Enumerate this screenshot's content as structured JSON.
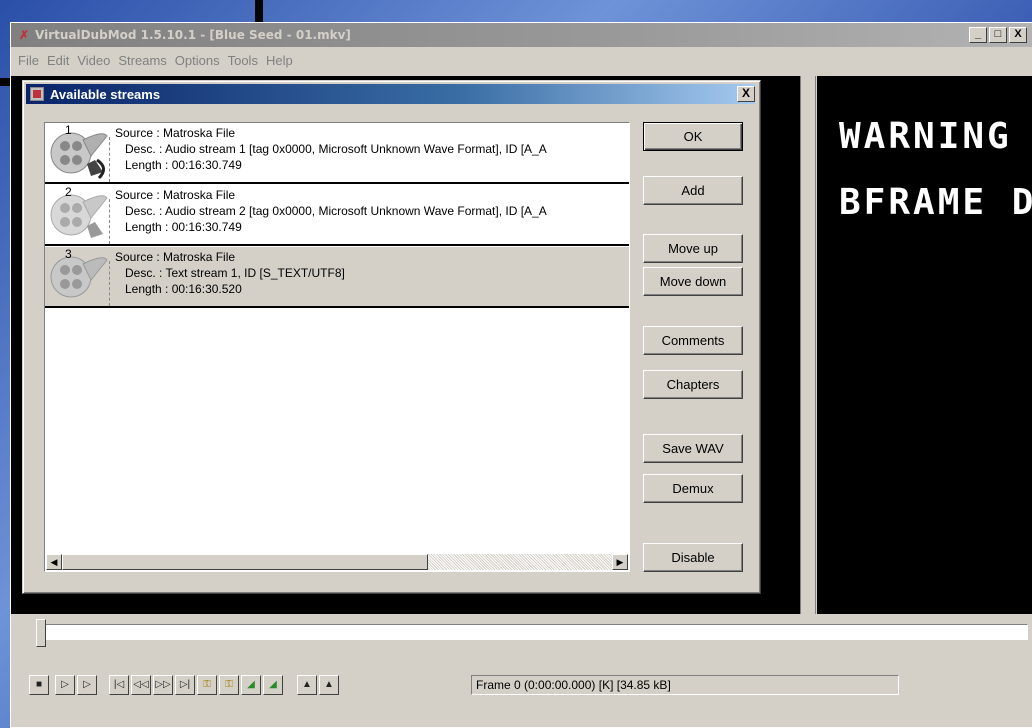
{
  "window": {
    "title": "VirtualDubMod 1.5.10.1 - [Blue Seed - 01.mkv]",
    "controls": [
      "_",
      "□",
      "X"
    ]
  },
  "menu": [
    "File",
    "Edit",
    "Video",
    "Streams",
    "Options",
    "Tools",
    "Help"
  ],
  "video": {
    "line1": "WARNING",
    "line2": "BFRAME D"
  },
  "dialog": {
    "title": "Available streams",
    "close": "X",
    "streams": [
      {
        "num": "1",
        "icon": "audio-stream-icon",
        "source": "Source : Matroska File",
        "desc": "Desc. : Audio stream 1 [tag 0x0000, Microsoft Unknown Wave Format], ID [A_A",
        "length": "Length : 00:16:30.749"
      },
      {
        "num": "2",
        "icon": "audio-stream-icon",
        "source": "Source : Matroska File",
        "desc": "Desc. : Audio stream 2 [tag 0x0000, Microsoft Unknown Wave Format], ID [A_A",
        "length": "Length : 00:16:30.749"
      },
      {
        "num": "3",
        "icon": "text-stream-icon",
        "source": "Source : Matroska File",
        "desc": "Desc. : Text stream 1, ID [S_TEXT/UTF8]",
        "length": "Length : 00:16:30.520"
      }
    ],
    "buttons": {
      "ok": "OK",
      "add": "Add",
      "move_up": "Move up",
      "move_down": "Move down",
      "comments": "Comments",
      "chapters": "Chapters",
      "save_wav": "Save WAV",
      "demux": "Demux",
      "disable": "Disable"
    }
  },
  "status": {
    "frame": "Frame 0 (0:00:00.000) [K] [34.85 kB]"
  }
}
